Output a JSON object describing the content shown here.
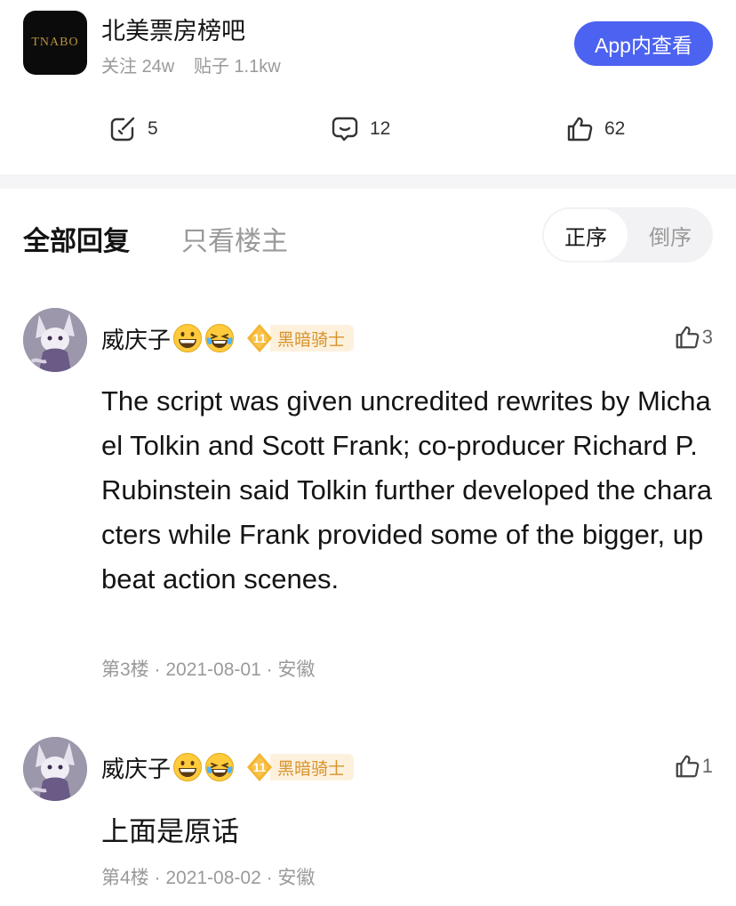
{
  "forum": {
    "logo_text": "TNABO",
    "name": "北美票房榜吧",
    "followers_label": "关注",
    "followers": "24w",
    "posts_label": "贴子",
    "posts": "1.1kw",
    "app_button": "App内查看"
  },
  "actions": {
    "share_count": "5",
    "comment_count": "12",
    "like_count": "62"
  },
  "tabs": {
    "all": "全部回复",
    "op_only": "只看楼主"
  },
  "sort": {
    "asc": "正序",
    "desc": "倒序",
    "selected": "正序"
  },
  "replies": [
    {
      "username": "威庆子",
      "emojis": [
        "grinning-face-icon",
        "laughing-tears-icon"
      ],
      "level": "11",
      "level_title": "黑暗骑士",
      "likes": "3",
      "text": "The script was given uncredited rewrites by Michael Tolkin and Scott Frank; co-producer Richard P. Rubinstein said Tolkin further developed the characters while Frank provided some of the bigger, upbeat action scenes.",
      "meta": "第3楼 · 2021-08-01 · 安徽"
    },
    {
      "username": "威庆子",
      "emojis": [
        "grinning-face-icon",
        "laughing-tears-icon"
      ],
      "level": "11",
      "level_title": "黑暗骑士",
      "likes": "1",
      "text": "上面是原话",
      "meta": "第4楼 · 2021-08-02 · 安徽"
    }
  ],
  "colors": {
    "accent": "#4c62f0",
    "badge_bg": "#fdf1de",
    "badge_text": "#d7932b",
    "muted": "#9a9a9a"
  }
}
